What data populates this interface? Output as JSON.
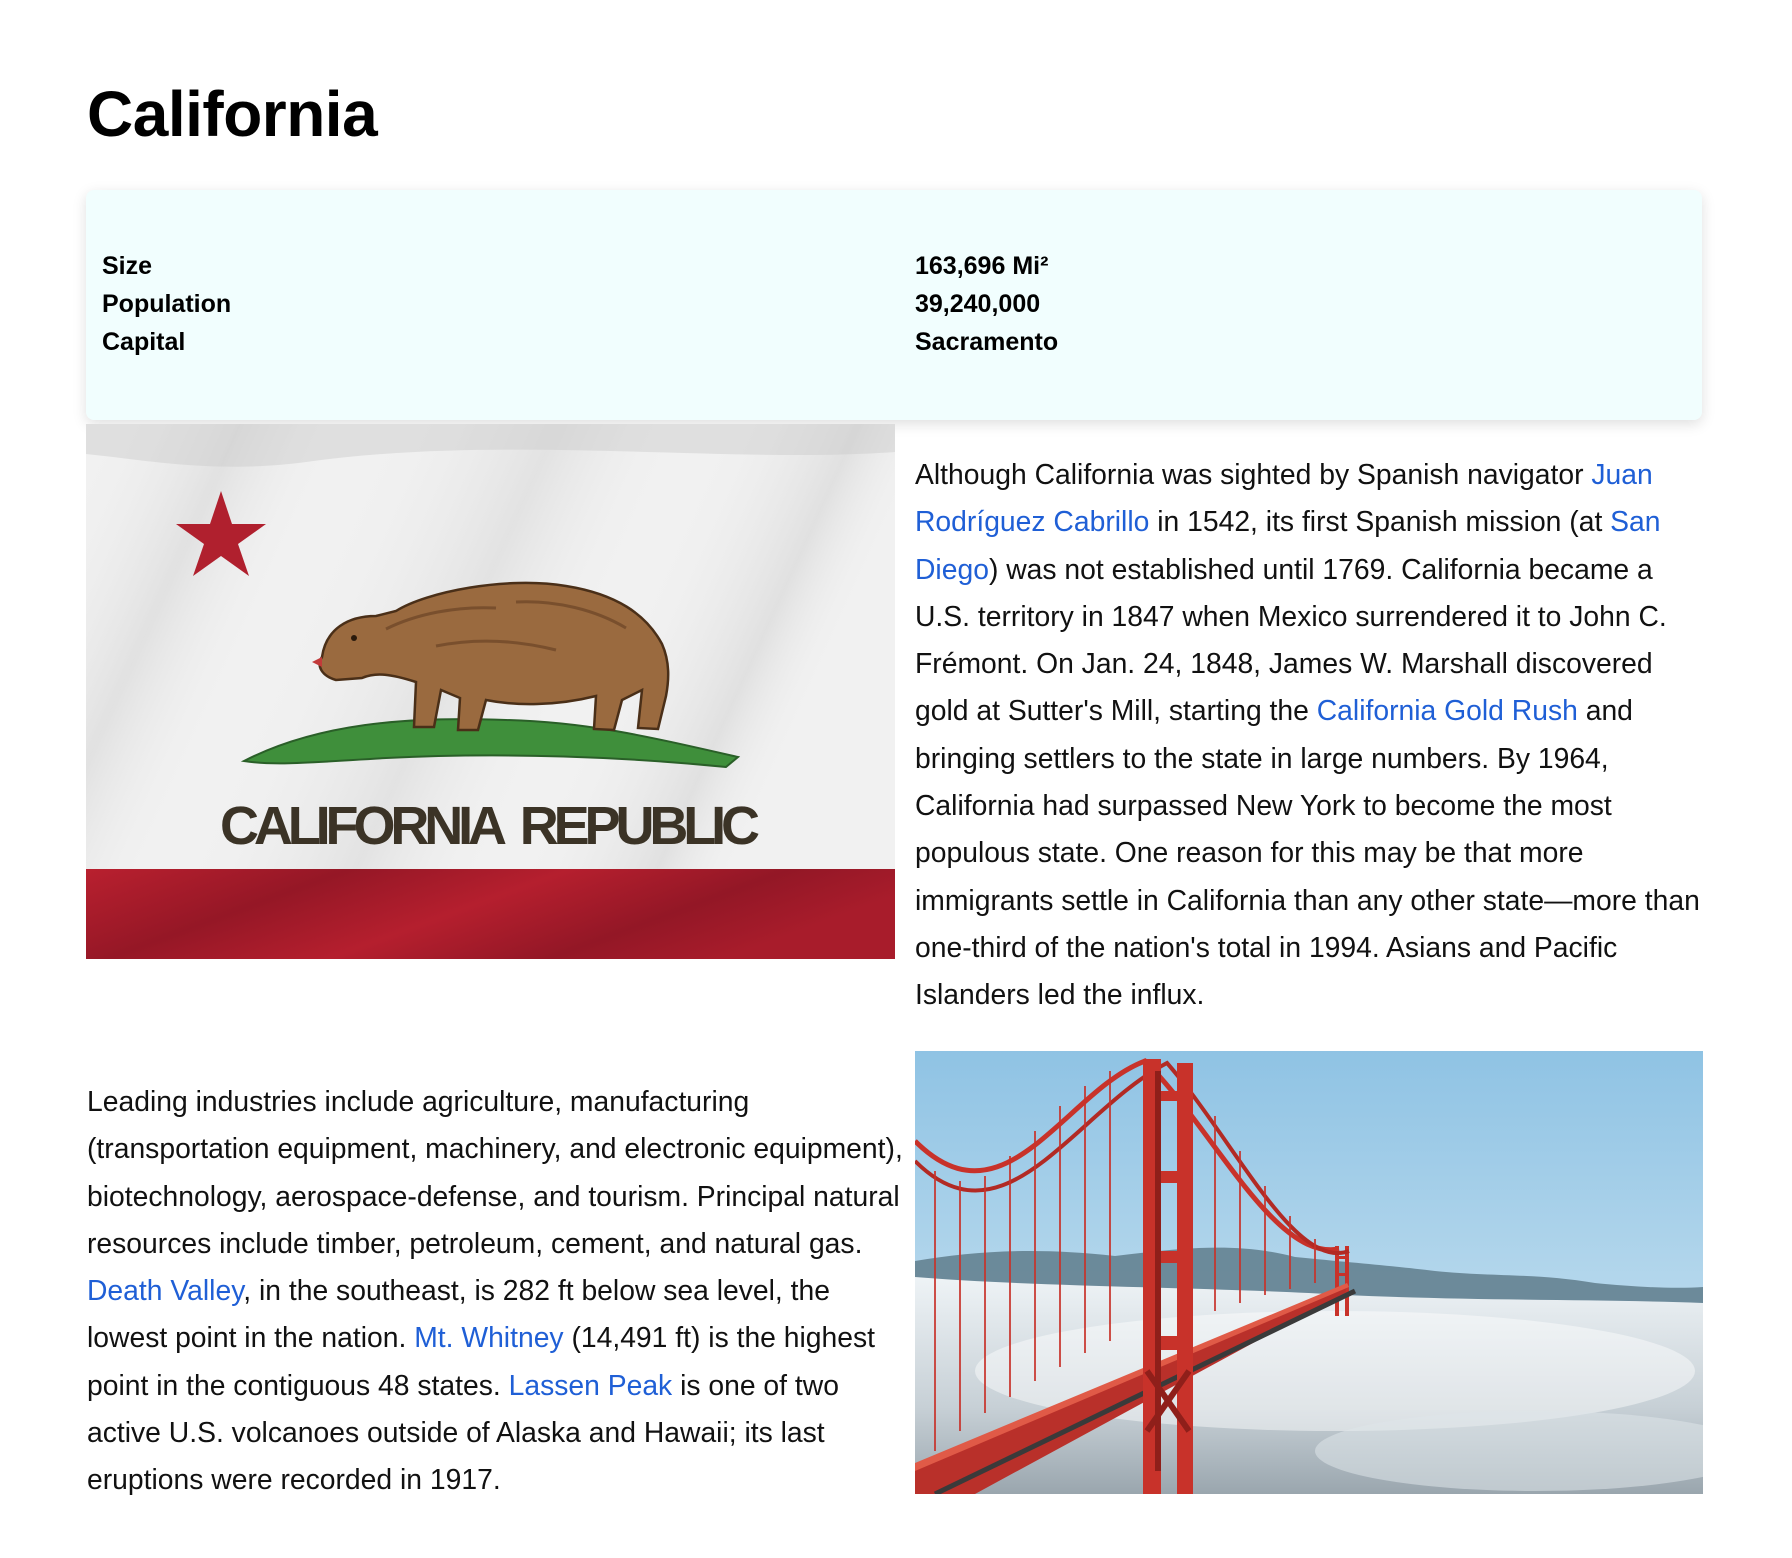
{
  "page": {
    "title": "California"
  },
  "facts": [
    {
      "label": "Size",
      "value": "163,696 Mi²"
    },
    {
      "label": "Population",
      "value": "39,240,000"
    },
    {
      "label": "Capital",
      "value": "Sacramento"
    }
  ],
  "flag_image": {
    "caption_text": "CALIFORNIA  REPUBLIC"
  },
  "history": {
    "t1": "Although California was sighted by Spanish navigator ",
    "link_cabrillo": "Juan Rodríguez Cabrillo",
    "t2": " in 1542, its first Spanish mission (at ",
    "link_san_diego": "San Diego",
    "t3": ") was not established until 1769. California became a U.S. territory in 1847 when Mexico surrendered it to John C. Frémont. On Jan. 24, 1848, James W. Marshall discovered gold at Sutter's Mill, starting the ",
    "link_gold_rush": "California Gold Rush",
    "t4": " and bringing settlers to the state in large numbers. By 1964, California had surpassed New York to become the most populous state. One reason for this may be that more immigrants settle in California than any other state—more than one-third of the nation's total in 1994. Asians and Pacific Islanders led the influx."
  },
  "economy": {
    "t1": "Leading industries include agriculture, manufacturing (transportation equipment, machinery, and electronic equipment), biotechnology, aerospace-defense, and tourism. Principal natural resources include timber, petroleum, cement, and natural gas. ",
    "link_death_valley": "Death Valley",
    "t2": ", in the southeast, is 282 ft below sea level, the lowest point in the nation. ",
    "link_whitney": "Mt. Whitney",
    "t3": " (14,491 ft) is the highest point in the contiguous 48 states. ",
    "link_lassen": "Lassen Peak",
    "t4": " is one of two active U.S. volcanoes outside of Alaska and Hawaii; its last eruptions were recorded in 1917."
  },
  "colors": {
    "link": "#1f5fd6",
    "facts_background": "#f1fefe",
    "flag_red": "#b0202e",
    "bridge_orange": "#c8322a"
  }
}
